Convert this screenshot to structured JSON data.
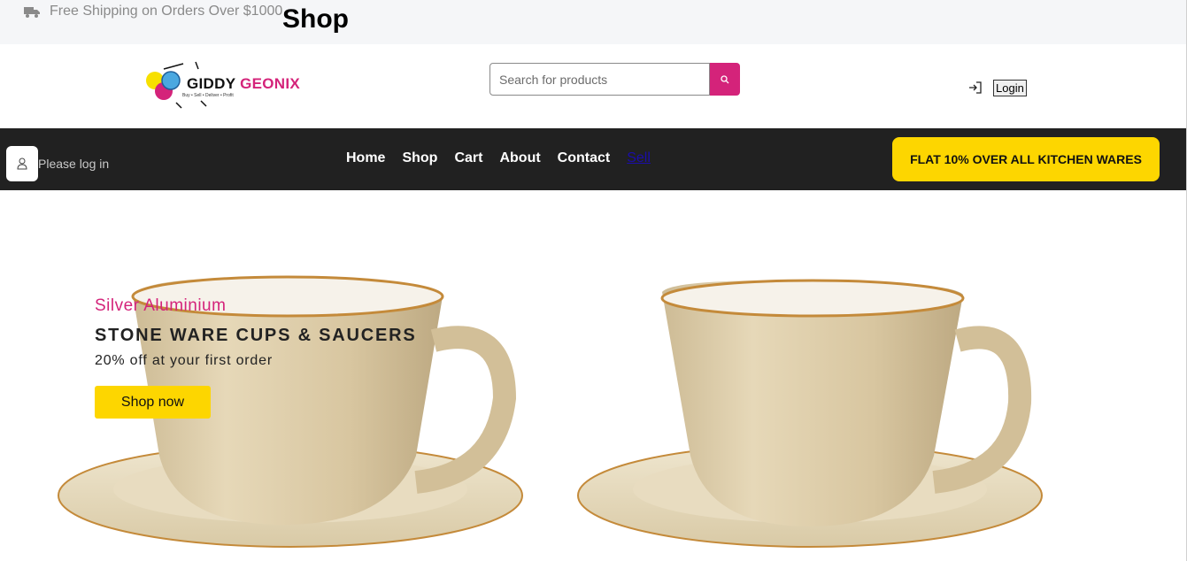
{
  "topbar": {
    "shipping_text": "Free Shipping on Orders Over $1000",
    "page_heading": "Shop",
    "shipping_icon": "truck-icon"
  },
  "header": {
    "logo": {
      "word1": "GIDDY",
      "word2": "GEONIX",
      "tagline": "Buy • Sell • Deliver • Profit"
    },
    "search": {
      "placeholder": "Search for products",
      "value": ""
    },
    "login_label": "Login"
  },
  "nav": {
    "user_prompt": "Please log in",
    "items": [
      {
        "label": "Home"
      },
      {
        "label": "Shop"
      },
      {
        "label": "Cart"
      },
      {
        "label": "About"
      },
      {
        "label": "Contact"
      },
      {
        "label": "Sell"
      }
    ],
    "promo": "FLAT 10% OVER ALL KITCHEN WARES"
  },
  "hero": {
    "subtitle": "Silver Aluminium",
    "title": "STONE WARE CUPS & SAUCERS",
    "offer": "20% off at your first order",
    "cta": "Shop now"
  },
  "colors": {
    "accent": "#d4237a",
    "promo_yellow": "#fdd600",
    "nav_bg": "#212121"
  }
}
